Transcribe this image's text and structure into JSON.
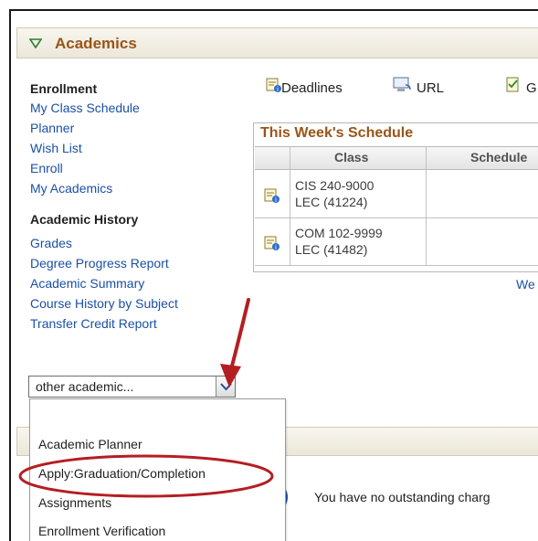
{
  "academics": {
    "title": "Academics",
    "enrollment_heading": "Enrollment",
    "enrollment_links": [
      "My Class Schedule",
      "Planner",
      "Wish List",
      "Enroll",
      "My Academics"
    ],
    "history_heading": "Academic History",
    "history_links": [
      "Grades",
      "Degree Progress Report",
      "Academic Summary",
      "Course History by Subject",
      "Transfer Credit Report"
    ]
  },
  "toolbar": {
    "deadlines": "Deadlines",
    "url": "URL",
    "third": "G"
  },
  "schedule": {
    "title": "This Week's Schedule",
    "columns": [
      "Class",
      "Schedule"
    ],
    "rows": [
      {
        "course": "CIS 240-9000",
        "section": "LEC (41224)"
      },
      {
        "course": "COM 102-9999",
        "section": "LEC (41482)"
      }
    ],
    "link_partial": "We"
  },
  "select": {
    "value": "other academic...",
    "options": [
      "Academic Planner",
      "Apply:Graduation/Completion",
      "Assignments",
      "Enrollment Verification"
    ],
    "highlighted_option": "Apply:Graduation/Completion"
  },
  "finances": {
    "message": "You have no outstanding charg"
  },
  "colors": {
    "link": "#1a50a5",
    "header_text": "#9a5418",
    "annotation_red": "#b41e23"
  }
}
